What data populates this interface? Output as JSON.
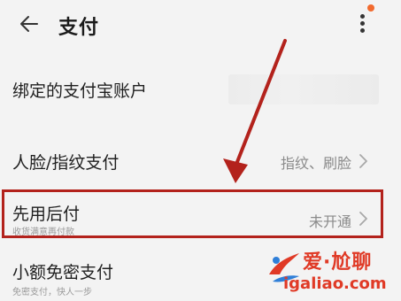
{
  "header": {
    "title": "支付",
    "back_icon": "arrow-left-icon",
    "more_icon": "more-vertical-icon",
    "notify_color": "#f26a2e"
  },
  "rows": [
    {
      "label": "绑定的支付宝账户",
      "sub": "",
      "value": ""
    },
    {
      "label": "人脸/指纹支付",
      "sub": "",
      "value": "指纹、刷脸"
    },
    {
      "label": "先用后付",
      "sub": "收货满意再付款",
      "value": "未开通"
    },
    {
      "label": "小额免密支付",
      "sub": "免密支付，快人一步",
      "value": ""
    }
  ],
  "annotation": {
    "color": "#b3221c"
  },
  "watermark": {
    "title": "爱·尬聊",
    "url": "igaliao.com",
    "color": "#e03a26"
  }
}
